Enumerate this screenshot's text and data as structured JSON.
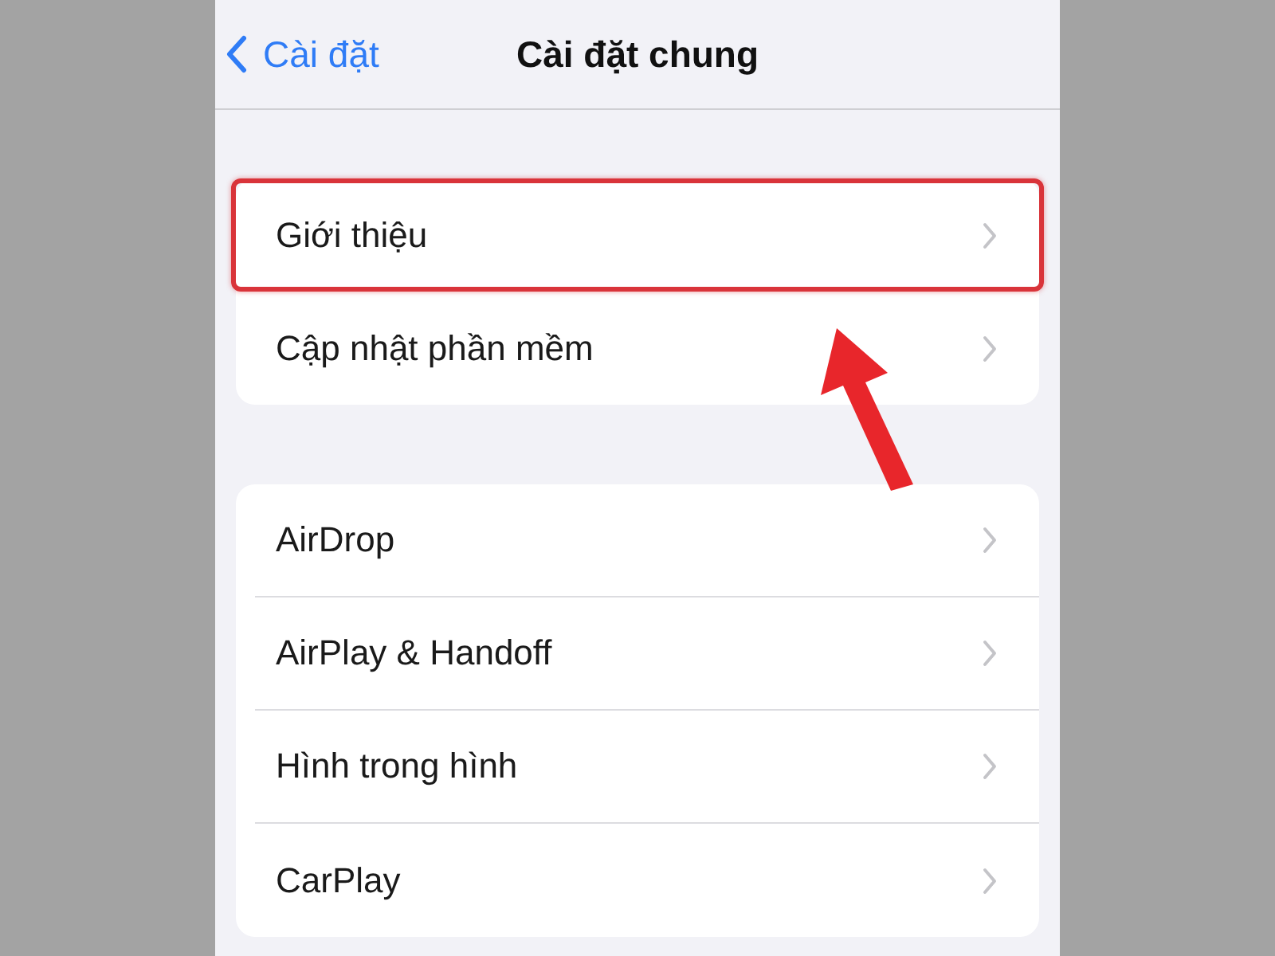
{
  "nav_bar": {
    "back_label": "Cài đặt",
    "title": "Cài đặt chung"
  },
  "groups": [
    {
      "items": [
        {
          "label": "Giới thiệu",
          "highlighted": true
        },
        {
          "label": "Cập nhật phần mềm",
          "highlighted": false
        }
      ]
    },
    {
      "items": [
        {
          "label": "AirDrop",
          "highlighted": false
        },
        {
          "label": "AirPlay & Handoff",
          "highlighted": false
        },
        {
          "label": "Hình trong hình",
          "highlighted": false
        },
        {
          "label": "CarPlay",
          "highlighted": false
        }
      ]
    }
  ]
}
